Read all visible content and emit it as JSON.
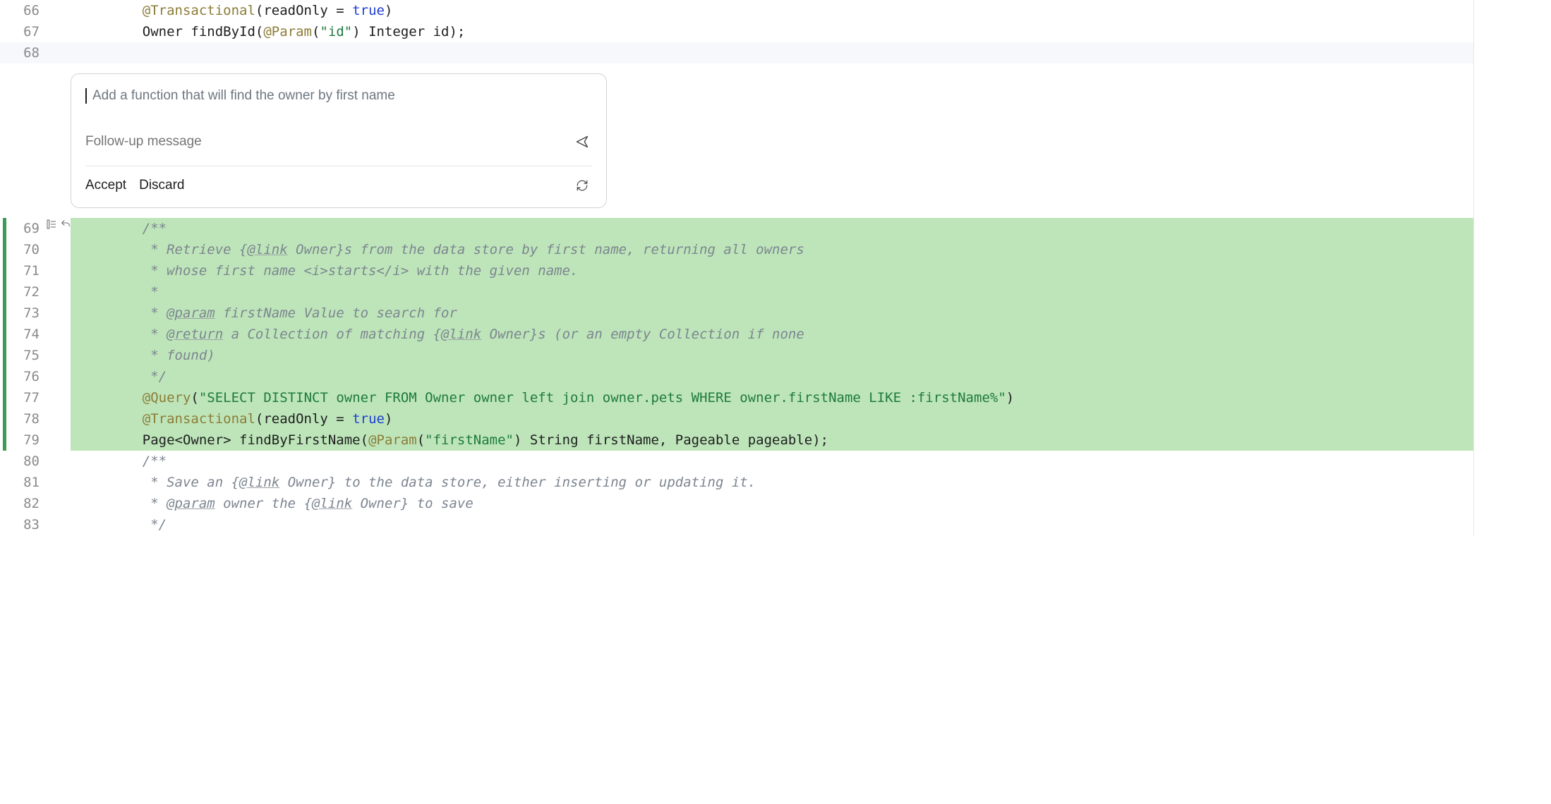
{
  "panel": {
    "prompt_text": "Add a function that will find the owner by first name",
    "followup_placeholder": "Follow-up message",
    "accept_label": "Accept",
    "discard_label": "Discard"
  },
  "gutter": {
    "l66": "66",
    "l67": "67",
    "l68": "68",
    "l69": "69",
    "l70": "70",
    "l71": "71",
    "l72": "72",
    "l73": "73",
    "l74": "74",
    "l75": "75",
    "l76": "76",
    "l77": "77",
    "l78": "78",
    "l79": "79",
    "l80": "80",
    "l81": "81",
    "l82": "82",
    "l83": "83"
  },
  "code": {
    "l66": {
      "ann": "@Transactional",
      "rest1": "(readOnly = ",
      "kw": "true",
      "rest2": ")"
    },
    "l67": {
      "t1": "Owner findById(",
      "ann": "@Param",
      "t2": "(",
      "str": "\"id\"",
      "t3": ") Integer id);"
    },
    "l68": "",
    "l69": "/**",
    "l70_a": " * Retrieve {",
    "l70_b": "@link",
    "l70_c": " Owner}s from the data store by first name, returning all owners",
    "l71": " * whose first name <i>starts</i> with the given name.",
    "l72": " *",
    "l73_a": " * ",
    "l73_b": "@param",
    "l73_c": " firstName Value to search for",
    "l74_a": " * ",
    "l74_b": "@return",
    "l74_c": " a Collection of matching {",
    "l74_d": "@link",
    "l74_e": " Owner}s (or an empty Collection if none",
    "l75": " * found)",
    "l76": " */",
    "l77": {
      "ann": "@Query",
      "t1": "(",
      "str": "\"SELECT DISTINCT owner FROM Owner owner left join owner.pets WHERE owner.firstName LIKE :firstName%\"",
      "t2": ")"
    },
    "l78": {
      "ann": "@Transactional",
      "t1": "(readOnly = ",
      "kw": "true",
      "t2": ")"
    },
    "l79": {
      "t1": "Page<Owner> findByFirstName(",
      "ann": "@Param",
      "t2": "(",
      "str": "\"firstName\"",
      "t3": ") String firstName, Pageable pageable);"
    },
    "l80": "/**",
    "l81_a": " * Save an {",
    "l81_b": "@link",
    "l81_c": " Owner} to the data store, either inserting or updating it.",
    "l82_a": " * ",
    "l82_b": "@param",
    "l82_c": " owner the {",
    "l82_d": "@link",
    "l82_e": " Owner} to save",
    "l83": " */"
  }
}
